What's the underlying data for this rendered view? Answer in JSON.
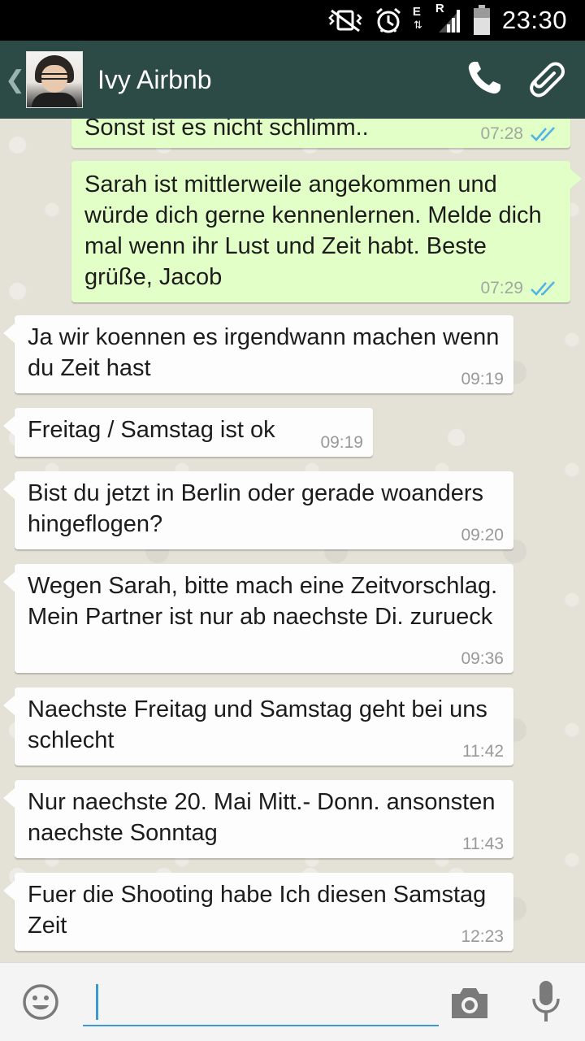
{
  "status_bar": {
    "time": "23:30",
    "network_type_1": "E",
    "network_type_2": "R",
    "icons": [
      "vibrate-mute-icon",
      "alarm-icon",
      "mobile-data-icon",
      "roaming-icon",
      "signal-icon",
      "battery-icon"
    ]
  },
  "header": {
    "contact_name": "Ivy Airbnb",
    "back_icon": "chevron-left-icon",
    "avatar": "contact-photo",
    "actions": [
      "phone-icon",
      "paperclip-icon"
    ],
    "bar_color": "#2c4a46"
  },
  "messages": [
    {
      "direction": "out",
      "text": "Sonst ist es nicht schlimm..",
      "time": "07:28",
      "status": "read"
    },
    {
      "direction": "out",
      "text": "Sarah ist mittlerweile angekommen und würde dich gerne kennenlernen. Melde dich mal wenn ihr Lust und Zeit habt. Beste grüße, Jacob",
      "time": "07:29",
      "status": "read"
    },
    {
      "direction": "in",
      "text": "Ja wir koennen es irgendwann machen wenn du Zeit hast",
      "time": "09:19"
    },
    {
      "direction": "in",
      "text": "Freitag / Samstag ist ok",
      "time": "09:19"
    },
    {
      "direction": "in",
      "text": "Bist du jetzt in Berlin oder gerade woanders hingeflogen?",
      "time": "09:20"
    },
    {
      "direction": "in",
      "text": "Wegen Sarah, bitte mach eine Zeitvorschlag. Mein Partner ist nur ab naechste Di. zurueck",
      "time": "09:36"
    },
    {
      "direction": "in",
      "text": "Naechste Freitag und Samstag geht bei uns schlecht",
      "time": "11:42"
    },
    {
      "direction": "in",
      "text": "Nur naechste 20. Mai Mitt.- Donn. ansonsten naechste Sonntag",
      "time": "11:43"
    },
    {
      "direction": "in",
      "text": "Fuer die Shooting habe Ich diesen Samstag Zeit",
      "time": "12:23"
    }
  ],
  "input_bar": {
    "message_value": "",
    "icons": [
      "emoji-icon",
      "camera-icon",
      "microphone-icon"
    ],
    "accent_color": "#3d9ad1"
  },
  "colors": {
    "outgoing_bubble": "#e2ffc7",
    "incoming_bubble": "#fdfdfd",
    "read_ticks": "#4fb3e8"
  }
}
